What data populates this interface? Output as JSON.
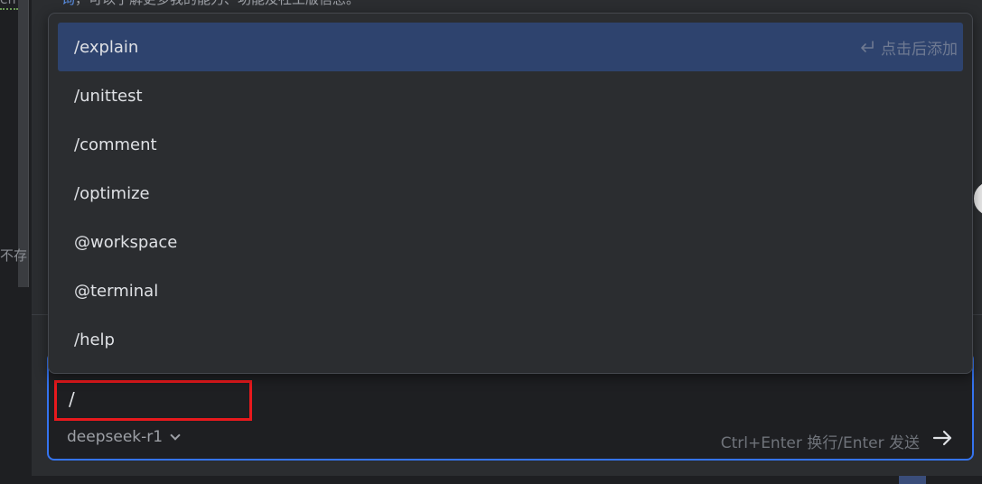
{
  "top_hint": {
    "prefix": "询",
    "text": "，可以了解更多我的能力、功能及社工版信息。"
  },
  "editor": {
    "left_top_text": "en",
    "left_text": "不存"
  },
  "suggestions": {
    "items": [
      {
        "label": "/explain",
        "selected": true
      },
      {
        "label": "/unittest"
      },
      {
        "label": "/comment"
      },
      {
        "label": "/optimize"
      },
      {
        "label": "@workspace"
      },
      {
        "label": "@terminal"
      },
      {
        "label": "/help"
      }
    ],
    "selected_hint": "点击后添加",
    "hint_icon": "enter-key-icon"
  },
  "input": {
    "value": "/",
    "model": "deepseek-r1",
    "send_hint": "Ctrl+Enter 换行/Enter 发送",
    "send_icon": "arrow-right-icon"
  },
  "colors": {
    "accent": "#3574f0",
    "selected_bg": "#2e436e",
    "highlight_outline": "#e8191d"
  }
}
